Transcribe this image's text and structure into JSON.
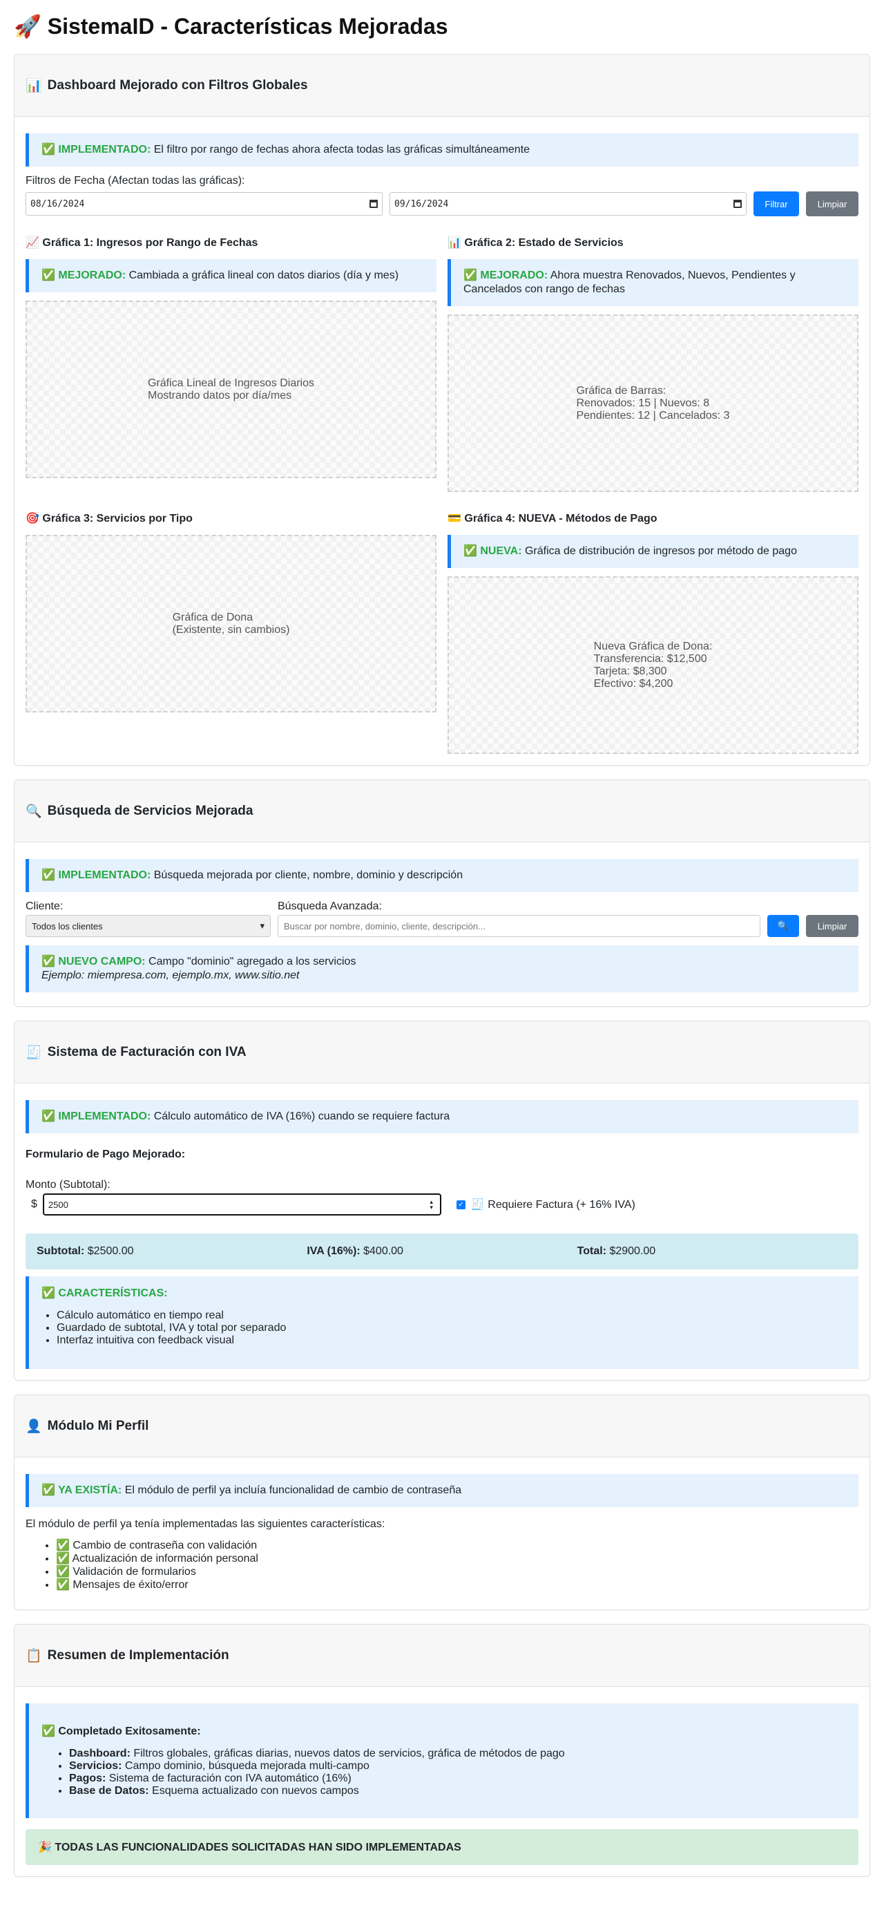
{
  "page": {
    "title": "🚀 SistemaID - Características Mejoradas"
  },
  "dashboard": {
    "icon": "📊",
    "title": "Dashboard Mejorado con Filtros Globales",
    "alert_tag": "✅ IMPLEMENTADO:",
    "alert_text": " El filtro por rango de fechas ahora afecta todas las gráficas simultáneamente",
    "filter_label": "Filtros de Fecha (Afectan todas las gráficas):",
    "date_from": "08/16/2024",
    "date_to": "09/16/2024",
    "filter_button": "Filtrar",
    "clear_button": "Limpiar",
    "charts": [
      {
        "title": "📈 Gráfica 1: Ingresos por Rango de Fechas",
        "alert_tag": "✅ MEJORADO:",
        "alert_text": " Cambiada a gráfica lineal con datos diarios (día y mes)",
        "placeholder": "Gráfica Lineal de Ingresos Diarios\nMostrando datos por día/mes"
      },
      {
        "title": "📊 Gráfica 2: Estado de Servicios",
        "alert_tag": "✅ MEJORADO:",
        "alert_text": " Ahora muestra Renovados, Nuevos, Pendientes y Cancelados con rango de fechas",
        "placeholder": "Gráfica de Barras:\nRenovados: 15 | Nuevos: 8\nPendientes: 12 | Cancelados: 3"
      },
      {
        "title": "🎯 Gráfica 3: Servicios por Tipo",
        "placeholder": "Gráfica de Dona\n(Existente, sin cambios)"
      },
      {
        "title": "💳 Gráfica 4: NUEVA - Métodos de Pago",
        "alert_tag": "✅ NUEVA:",
        "alert_text": " Gráfica de distribución de ingresos por método de pago",
        "placeholder": "Nueva Gráfica de Dona:\nTransferencia: $12,500\nTarjeta: $8,300\nEfectivo: $4,200"
      }
    ]
  },
  "search": {
    "icon": "🔍",
    "title": "Búsqueda de Servicios Mejorada",
    "alert_tag": "✅ IMPLEMENTADO:",
    "alert_text": " Búsqueda mejorada por cliente, nombre, dominio y descripción",
    "client_label": "Cliente:",
    "client_value": "Todos los clientes",
    "advanced_label": "Búsqueda Avanzada:",
    "advanced_placeholder": "Buscar por nombre, dominio, cliente, descripción...",
    "search_button": "🔍",
    "clear_button": "Limpiar",
    "new_field_tag": "✅ NUEVO CAMPO:",
    "new_field_text": " Campo \"dominio\" agregado a los servicios",
    "example": "Ejemplo: miempresa.com, ejemplo.mx, www.sitio.net"
  },
  "billing": {
    "icon": "🧾",
    "title": "Sistema de Facturación con IVA",
    "alert_tag": "✅ IMPLEMENTADO:",
    "alert_text": " Cálculo automático de IVA (16%) cuando se requiere factura",
    "form_title": "Formulario de Pago Mejorado:",
    "amount_label": "Monto (Subtotal):",
    "currency": "$",
    "amount_value": "2500",
    "invoice_label": "🧾 Requiere Factura (+ 16% IVA)",
    "invoice_checked": true,
    "subtotal_label": "Subtotal:",
    "subtotal_value": " $2500.00",
    "iva_label": "IVA (16%):",
    "iva_value": " $400.00",
    "total_label": "Total:",
    "total_value": " $2900.00",
    "features_title": "✅ CARACTERÍSTICAS:",
    "features": [
      "Cálculo automático en tiempo real",
      "Guardado de subtotal, IVA y total por separado",
      "Interfaz intuitiva con feedback visual"
    ]
  },
  "profile": {
    "icon": "👤",
    "title": "Módulo Mi Perfil",
    "alert_tag": "✅ YA EXISTÍA:",
    "alert_text": " El módulo de perfil ya incluía funcionalidad de cambio de contraseña",
    "intro": "El módulo de perfil ya tenía implementadas las siguientes características:",
    "items": [
      "✅ Cambio de contraseña con validación",
      "✅ Actualización de información personal",
      "✅ Validación de formularios",
      "✅ Mensajes de éxito/error"
    ]
  },
  "summary": {
    "icon": "📋",
    "title": "Resumen de Implementación",
    "box_title": "✅ Completado Exitosamente:",
    "items": [
      {
        "label": "Dashboard:",
        "text": " Filtros globales, gráficas diarias, nuevos datos de servicios, gráfica de métodos de pago"
      },
      {
        "label": "Servicios:",
        "text": " Campo dominio, búsqueda mejorada multi-campo"
      },
      {
        "label": "Pagos:",
        "text": " Sistema de facturación con IVA automático (16%)"
      },
      {
        "label": "Base de Datos:",
        "text": " Esquema actualizado con nuevos campos"
      }
    ],
    "banner": "🎉 TODAS LAS FUNCIONALIDADES SOLICITADAS HAN SIDO IMPLEMENTADAS"
  }
}
